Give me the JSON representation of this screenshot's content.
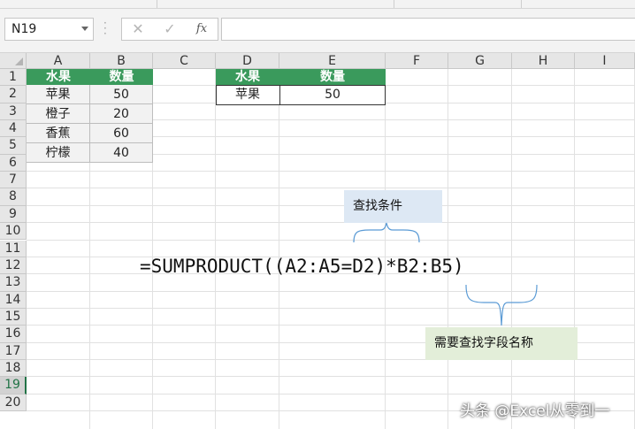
{
  "name_box": {
    "value": "N19"
  },
  "formula_bar": {
    "cancel_glyph": "✕",
    "confirm_glyph": "✓",
    "fx_label": "fx",
    "value": ""
  },
  "columns": [
    "A",
    "B",
    "C",
    "D",
    "E",
    "F",
    "G",
    "H",
    "I"
  ],
  "rows": [
    "1",
    "2",
    "3",
    "4",
    "5",
    "6",
    "7",
    "8",
    "9",
    "10",
    "11",
    "12",
    "13",
    "14",
    "15",
    "16",
    "17",
    "18",
    "19",
    "20"
  ],
  "active_row": "19",
  "source_table": {
    "headers": [
      "水果",
      "数量"
    ],
    "rows": [
      [
        "苹果",
        "50"
      ],
      [
        "橙子",
        "20"
      ],
      [
        "香蕉",
        "60"
      ],
      [
        "柠檬",
        "40"
      ]
    ]
  },
  "lookup_table": {
    "headers": [
      "水果",
      "数量"
    ],
    "row": [
      "苹果",
      "50"
    ]
  },
  "annotations": {
    "formula": "=SUMPRODUCT((A2:A5=D2)*B2:B5)",
    "lookup_condition": "查找条件",
    "field_name": "需要查找字段名称"
  },
  "watermark": "头条 @Excel从零到一",
  "colors": {
    "header_green": "#3a9a5c",
    "note_blue": "#dde8f4",
    "note_green": "#e3eed9",
    "brace_blue": "#5b9bd5"
  }
}
